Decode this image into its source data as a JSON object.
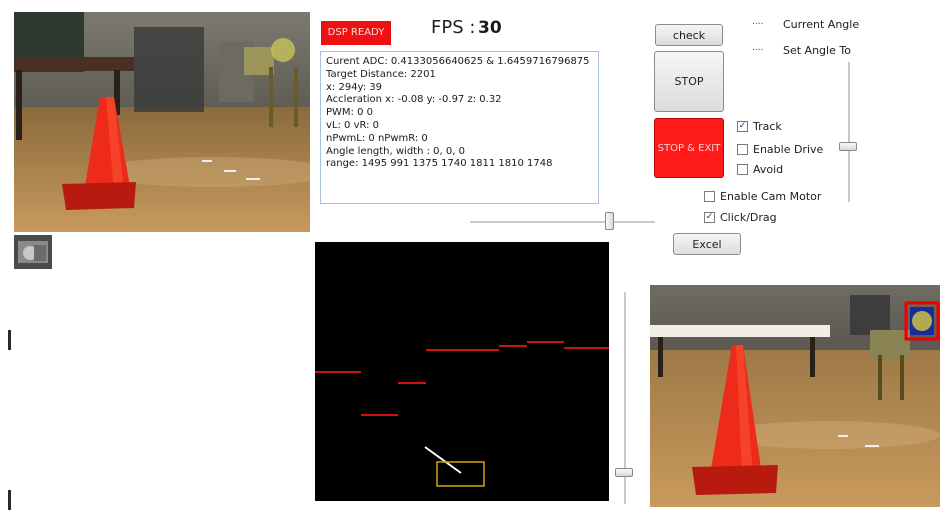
{
  "status": {
    "dsp_label": "DSP READY",
    "fps_label": "FPS :",
    "fps_value": "30"
  },
  "info": {
    "lines": [
      "Curent ADC: 0.4133056640625 & 1.6459716796875",
      "Target Distance: 2201",
      "x: 294y: 39",
      "Accleration  x: -0.08 y: -0.97 z: 0.32",
      "PWM: 0   0",
      "vL: 0  vR: 0",
      "nPwmL: 0  nPwmR: 0",
      "Angle length, width :  0,  0,  0",
      "range: 1495 991 1375 1740 1811 1810 1748"
    ]
  },
  "buttons": {
    "check": "check",
    "stop": "STOP",
    "stop_exit": "STOP & EXIT",
    "excel": "Excel"
  },
  "angles": {
    "dots": "....",
    "current": "Current Angle",
    "set": "Set Angle To"
  },
  "checkboxes": {
    "track": {
      "label": "Track",
      "checked": true,
      "mark": "✓"
    },
    "enable_drive": {
      "label": "Enable Drive",
      "checked": false
    },
    "avoid": {
      "label": "Avoid",
      "checked": false
    },
    "enable_cam_motor": {
      "label": "Enable Cam Motor",
      "checked": false
    },
    "click_drag": {
      "label": "Click/Drag",
      "checked": true,
      "mark": "✓"
    }
  },
  "sliders": {
    "angle_level": 0.6,
    "horizontal_level": 0.75,
    "map_level": 0.85
  },
  "colors": {
    "dsp_bg": "#ee1111",
    "stop_exit_bg": "#ff1a1a",
    "range_line": "#cc1111",
    "target_box": "#d4a017"
  },
  "icons": [
    "camera-view-main",
    "camera-thumbnail",
    "camera-view-tracking",
    "tracking-target-marker"
  ]
}
